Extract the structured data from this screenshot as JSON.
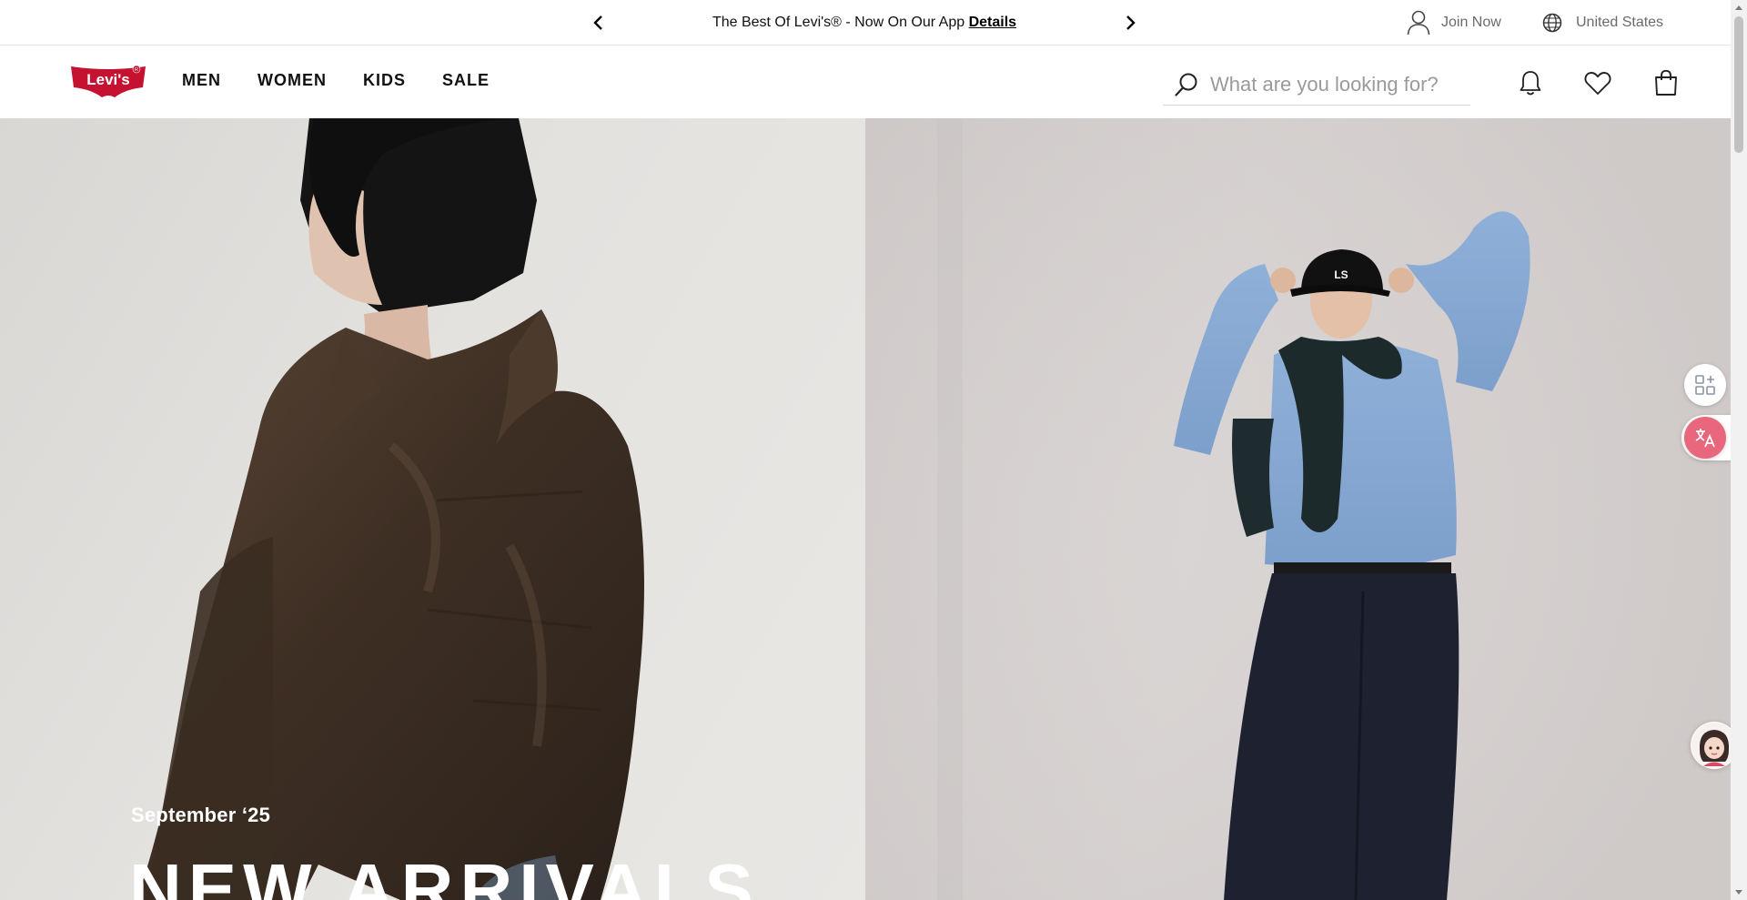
{
  "promo": {
    "text": "The Best Of Levi's® - Now On Our App",
    "link": "Details",
    "prev_icon": "chevron-left-icon",
    "next_icon": "chevron-right-icon"
  },
  "utility": {
    "join_label": "Join Now",
    "join_icon": "user-icon",
    "country_label": "United States",
    "country_icon": "globe-icon"
  },
  "header": {
    "logo_text": "Levi's",
    "nav": [
      "MEN",
      "WOMEN",
      "KIDS",
      "SALE"
    ],
    "search_placeholder": "What are you looking for?",
    "icons": [
      "bell-icon",
      "heart-icon",
      "shopping-bag-icon"
    ]
  },
  "hero": {
    "season": "September ‘25",
    "headline": "NEW ARRIVALS"
  },
  "widgets": {
    "apps_icon": "apps-plus-icon",
    "translate_icon": "translate-icon",
    "chat_icon": "chat-avatar-icon"
  },
  "colors": {
    "brand_red": "#c41230",
    "text": "#111111",
    "muted": "#6b6b6b"
  }
}
